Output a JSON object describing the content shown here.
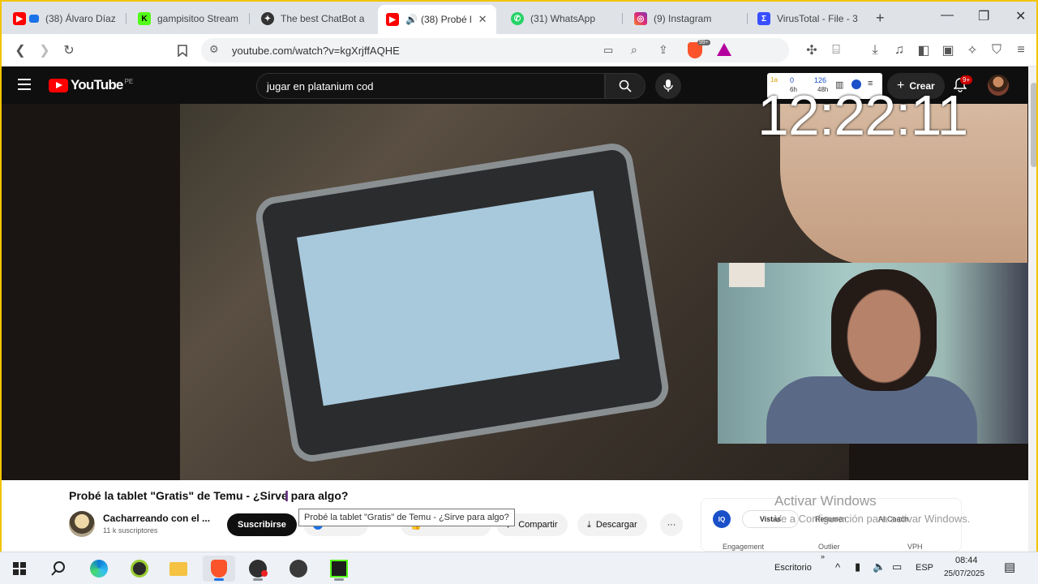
{
  "browser": {
    "tabs": [
      {
        "label": "(38) Álvaro Díaz",
        "icon": "youtube-icon"
      },
      {
        "label": "gampisitoo Stream",
        "icon": "kick-icon"
      },
      {
        "label": "The best ChatBot a",
        "icon": "chatbot-icon"
      },
      {
        "label": "(38) Probé l",
        "icon": "youtube-icon"
      },
      {
        "label": "(31) WhatsApp",
        "icon": "whatsapp-icon"
      },
      {
        "label": "(9) Instagram",
        "icon": "instagram-icon"
      },
      {
        "label": "VirusTotal - File - 3",
        "icon": "virustotal-icon"
      }
    ],
    "ext_badge": "99+",
    "url": "youtube.com/watch?v=kgXrjffAQHE"
  },
  "youtube": {
    "logo_text": "YouTube",
    "country_code": "PE",
    "search_query": "jugar en platanium cod",
    "create_label": "Crear",
    "notifications": "9+",
    "ext_widget": {
      "a": "1a",
      "b": "0",
      "b_sub": "6h",
      "c": "126",
      "c_sub": "48h"
    }
  },
  "overlay": {
    "clock": "12:22:11"
  },
  "video": {
    "title": "Probé la tablet \"Gratis\" de Temu - ¿Sirve para algo?",
    "tooltip": "Probé la tablet \"Gratis\" de Temu - ¿Sirve para algo?",
    "channel_name": "Cacharreando con el ...",
    "subscribers": "11 k suscriptores",
    "subscribe_label": "Suscribirse",
    "share_label": "Compartir",
    "download_label": "Descargar",
    "more_label": "···"
  },
  "analytics_panel": {
    "logo": "IQ",
    "tabs": [
      "Vistas",
      "Resumen",
      "AI Coach"
    ],
    "metrics": [
      "Engagement",
      "Outlier",
      "VPH"
    ]
  },
  "windows_watermark": {
    "line1": "Activar Windows",
    "line2": "Ve a Configuración para activar Windows."
  },
  "taskbar": {
    "desktop_label": "Escritorio",
    "language": "ESP",
    "time": "08:44",
    "date": "25/07/2025"
  },
  "colors": {
    "youtube_red": "#ff0000",
    "youtube_dark": "#0f0f0f",
    "tab_strip": "#dfe3e8",
    "window_border": "#f2c400"
  }
}
